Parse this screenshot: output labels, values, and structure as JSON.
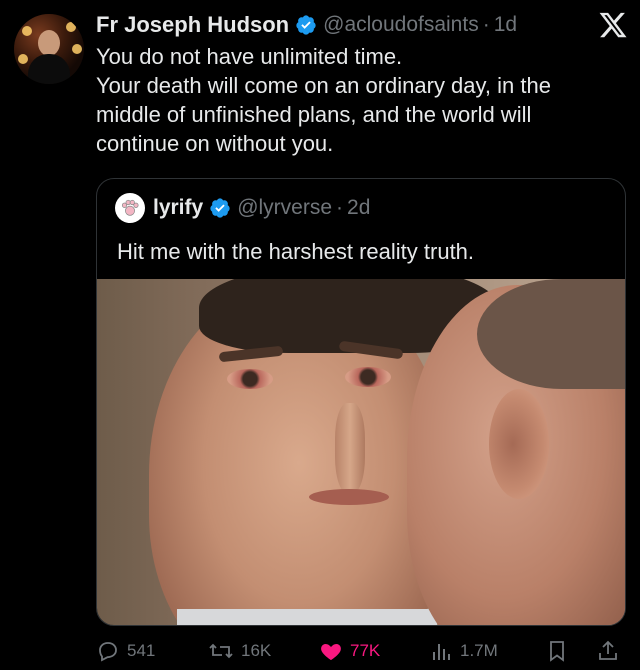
{
  "tweet": {
    "author_name": "Fr Joseph Hudson",
    "author_handle": "@acloudofsaints",
    "separator": "·",
    "time": "1d",
    "text_lines": [
      "You do not have unlimited time.",
      "Your death will come on an ordinary day, in the",
      "middle of unfinished plans, and the world will",
      "continue on without you."
    ]
  },
  "quote": {
    "author_name": "lyrify",
    "author_handle": "@lyrverse",
    "separator": "·",
    "time": "2d",
    "text": "Hit me with the harshest reality truth."
  },
  "actions": {
    "replies": "541",
    "reposts": "16K",
    "likes": "77K",
    "views": "1.7M"
  },
  "icons": {
    "logo": "x-logo-icon",
    "verified": "verified-badge-icon",
    "reply": "reply-icon",
    "repost": "repost-icon",
    "like": "heart-icon",
    "views": "views-icon",
    "bookmark": "bookmark-icon",
    "share": "share-icon"
  },
  "colors": {
    "background": "#000000",
    "text": "#e7e9ea",
    "muted": "#71767b",
    "verified": "#1d9bf0",
    "like": "#f91880",
    "border": "#2f3336"
  }
}
